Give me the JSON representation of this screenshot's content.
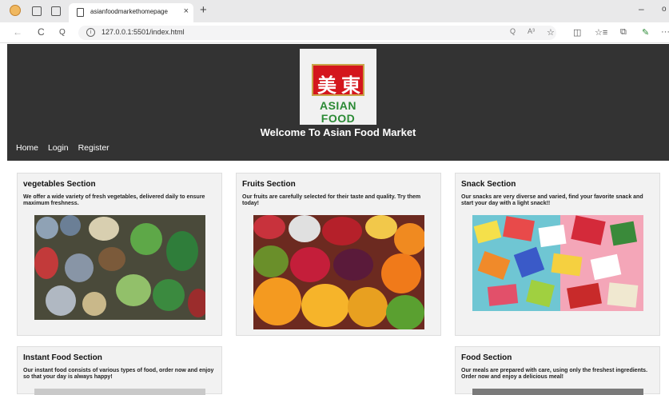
{
  "browser": {
    "tab_title": "asianfoodmarkethomepage",
    "tab_close": "×",
    "new_tab": "+",
    "minimize": "–",
    "window_glyph": "ο",
    "url": "127.0.0.1:5501/index.html",
    "nav": {
      "back": "←",
      "reload": "C",
      "search": "Q"
    },
    "info": "i",
    "url_right": {
      "zoom": "Q",
      "read_aloud": "A³"
    },
    "toolbar": {
      "favorite": "☆",
      "split": "◫",
      "favorites_list": "☆≡",
      "collections": "⧉",
      "extensions": "✎",
      "menu": "···"
    }
  },
  "header": {
    "logo_chars": [
      "美",
      "東"
    ],
    "logo_text": "ASIAN FOOD",
    "welcome": "Welcome To Asian Food Market",
    "nav": [
      "Home",
      "Login",
      "Register"
    ]
  },
  "sections": [
    {
      "title": "vegetables Section",
      "text": "We offer a wide variety of fresh vegetables, delivered daily to ensure maximum freshness."
    },
    {
      "title": "Fruits Section",
      "text": "Our fruits are carefully selected for their taste and quality. Try them today!"
    },
    {
      "title": "Snack Section",
      "text": "Our snacks are very diverse and varied, find your favorite snack and start your day with a light snack!!"
    },
    {
      "title": "Instant Food Section",
      "text": "Our instant food consists of various types of food, order now and enjoy so that your day is always happy!"
    },
    {
      "title": "Food Section",
      "text": "Our meals are prepared with care, using only the freshest ingredients. Order now and enjoy a delicious meal!"
    }
  ],
  "colors": {
    "header_bg": "#333333",
    "card_bg": "#f2f2f2",
    "logo_red": "#d4161d",
    "logo_green": "#2b8a35"
  }
}
